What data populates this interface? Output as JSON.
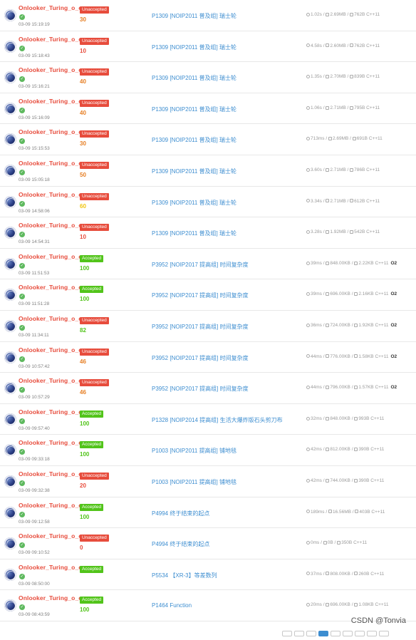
{
  "records": [
    {
      "user": "Onlooker_Turing_o_o",
      "time": "03-09 15:19:19",
      "status": "Unaccepted",
      "score": "30",
      "score_color": "#e67e22",
      "problem": "P1309 [NOIP2011 普及组] 瑞士轮",
      "runtime": "1.02s",
      "memory": "2.69MB",
      "code": "762B C++11",
      "o2": ""
    },
    {
      "user": "Onlooker_Turing_o_o",
      "time": "03-09 15:18:43",
      "status": "Unaccepted",
      "score": "10",
      "score_color": "#e74c3c",
      "problem": "P1309 [NOIP2011 普及组] 瑞士轮",
      "runtime": "4.58s",
      "memory": "2.60MB",
      "code": "762B C++11",
      "o2": ""
    },
    {
      "user": "Onlooker_Turing_o_o",
      "time": "03-09 15:16:21",
      "status": "Unaccepted",
      "score": "40",
      "score_color": "#e67e22",
      "problem": "P1309 [NOIP2011 普及组] 瑞士轮",
      "runtime": "1.35s",
      "memory": "2.70MB",
      "code": "839B C++11",
      "o2": ""
    },
    {
      "user": "Onlooker_Turing_o_o",
      "time": "03-09 15:16:09",
      "status": "Unaccepted",
      "score": "40",
      "score_color": "#e67e22",
      "problem": "P1309 [NOIP2011 普及组] 瑞士轮",
      "runtime": "1.06s",
      "memory": "2.71MB",
      "code": "795B C++11",
      "o2": ""
    },
    {
      "user": "Onlooker_Turing_o_o",
      "time": "03-09 15:15:53",
      "status": "Unaccepted",
      "score": "30",
      "score_color": "#e67e22",
      "problem": "P1309 [NOIP2011 普及组] 瑞士轮",
      "runtime": "713ms",
      "memory": "2.69MB",
      "code": "691B C++11",
      "o2": ""
    },
    {
      "user": "Onlooker_Turing_o_o",
      "time": "03-09 15:05:18",
      "status": "Unaccepted",
      "score": "50",
      "score_color": "#e67e22",
      "problem": "P1309 [NOIP2011 普及组] 瑞士轮",
      "runtime": "3.60s",
      "memory": "2.71MB",
      "code": "786B C++11",
      "o2": ""
    },
    {
      "user": "Onlooker_Turing_o_o",
      "time": "03-09 14:58:06",
      "status": "Unaccepted",
      "score": "60",
      "score_color": "#f1c40f",
      "problem": "P1309 [NOIP2011 普及组] 瑞士轮",
      "runtime": "3.34s",
      "memory": "2.71MB",
      "code": "612B C++11",
      "o2": ""
    },
    {
      "user": "Onlooker_Turing_o_o",
      "time": "03-09 14:54:31",
      "status": "Unaccepted",
      "score": "10",
      "score_color": "#e74c3c",
      "problem": "P1309 [NOIP2011 普及组] 瑞士轮",
      "runtime": "3.28s",
      "memory": "1.92MB",
      "code": "542B C++11",
      "o2": ""
    },
    {
      "user": "Onlooker_Turing_o_o",
      "time": "03-09 11:51:53",
      "status": "Accepted",
      "score": "100",
      "score_color": "#52c41a",
      "problem": "P3952 [NOIP2017 提高组] 时间复杂度",
      "runtime": "39ms",
      "memory": "848.00KB",
      "code": "2.22KB C++11",
      "o2": "O2"
    },
    {
      "user": "Onlooker_Turing_o_o",
      "time": "03-09 11:51:28",
      "status": "Accepted",
      "score": "100",
      "score_color": "#52c41a",
      "problem": "P3952 [NOIP2017 提高组] 时间复杂度",
      "runtime": "39ms",
      "memory": "696.00KB",
      "code": "2.16KB C++11",
      "o2": "O2"
    },
    {
      "user": "Onlooker_Turing_o_o",
      "time": "03-09 11:34:11",
      "status": "Unaccepted",
      "score": "82",
      "score_color": "#52c41a",
      "problem": "P3952 [NOIP2017 提高组] 时间复杂度",
      "runtime": "36ms",
      "memory": "724.00KB",
      "code": "1.92KB C++11",
      "o2": "O2"
    },
    {
      "user": "Onlooker_Turing_o_o",
      "time": "03-09 10:57:42",
      "status": "Unaccepted",
      "score": "46",
      "score_color": "#e67e22",
      "problem": "P3952 [NOIP2017 提高组] 时间复杂度",
      "runtime": "44ms",
      "memory": "776.00KB",
      "code": "1.58KB C++11",
      "o2": "O2"
    },
    {
      "user": "Onlooker_Turing_o_o",
      "time": "03-09 10:57:29",
      "status": "Unaccepted",
      "score": "46",
      "score_color": "#e67e22",
      "problem": "P3952 [NOIP2017 提高组] 时间复杂度",
      "runtime": "44ms",
      "memory": "796.00KB",
      "code": "1.57KB C++11",
      "o2": "O2"
    },
    {
      "user": "Onlooker_Turing_o_o",
      "time": "03-09 09:57:40",
      "status": "Accepted",
      "score": "100",
      "score_color": "#52c41a",
      "problem": "P1328 [NOIP2014 提高组] 生活大爆炸版石头剪刀布",
      "runtime": "32ms",
      "memory": "848.00KB",
      "code": "993B C++11",
      "o2": ""
    },
    {
      "user": "Onlooker_Turing_o_o",
      "time": "03-09 09:33:18",
      "status": "Accepted",
      "score": "100",
      "score_color": "#52c41a",
      "problem": "P1003 [NOIP2011 提高组] 铺地毯",
      "runtime": "42ms",
      "memory": "812.00KB",
      "code": "390B C++11",
      "o2": ""
    },
    {
      "user": "Onlooker_Turing_o_o",
      "time": "03-09 09:32:38",
      "status": "Unaccepted",
      "score": "20",
      "score_color": "#e74c3c",
      "problem": "P1003 [NOIP2011 提高组] 铺地毯",
      "runtime": "42ms",
      "memory": "744.00KB",
      "code": "390B C++11",
      "o2": ""
    },
    {
      "user": "Onlooker_Turing_o_o",
      "time": "03-09 09:12:58",
      "status": "Accepted",
      "score": "100",
      "score_color": "#52c41a",
      "problem": "P4994 终于结束的起点",
      "runtime": "189ms",
      "memory": "16.56MB",
      "code": "403B C++11",
      "o2": ""
    },
    {
      "user": "Onlooker_Turing_o_o",
      "time": "03-09 09:10:52",
      "status": "Unaccepted",
      "score": "0",
      "score_color": "#e74c3c",
      "problem": "P4994 终于结束的起点",
      "runtime": "0ms",
      "memory": "0B",
      "code": "350B C++11",
      "o2": ""
    },
    {
      "user": "Onlooker_Turing_o_o",
      "time": "03-09 08:50:00",
      "status": "Accepted",
      "score": "",
      "score_color": "#52c41a",
      "problem": "P5534 【XR-3】等差数列",
      "runtime": "37ms",
      "memory": "808.00KB",
      "code": "260B C++11",
      "o2": ""
    },
    {
      "user": "Onlooker_Turing_o_o",
      "time": "03-09 08:43:59",
      "status": "Accepted",
      "score": "100",
      "score_color": "#52c41a",
      "problem": "P1464 Function",
      "runtime": "20ms",
      "memory": "696.00KB",
      "code": "1.08KB C++11",
      "o2": ""
    }
  ],
  "colors": {
    "accepted": "#52c41a",
    "unaccepted": "#e74c3c",
    "link": "#3c8dd0",
    "username": "#e74c3c"
  },
  "icons": {
    "runtime": "clock-icon",
    "memory": "memory-icon",
    "code": "file-icon",
    "check": "check-icon"
  },
  "pager": {
    "active_index": 3,
    "count": 9
  },
  "watermark": "CSDN @Tonvia"
}
